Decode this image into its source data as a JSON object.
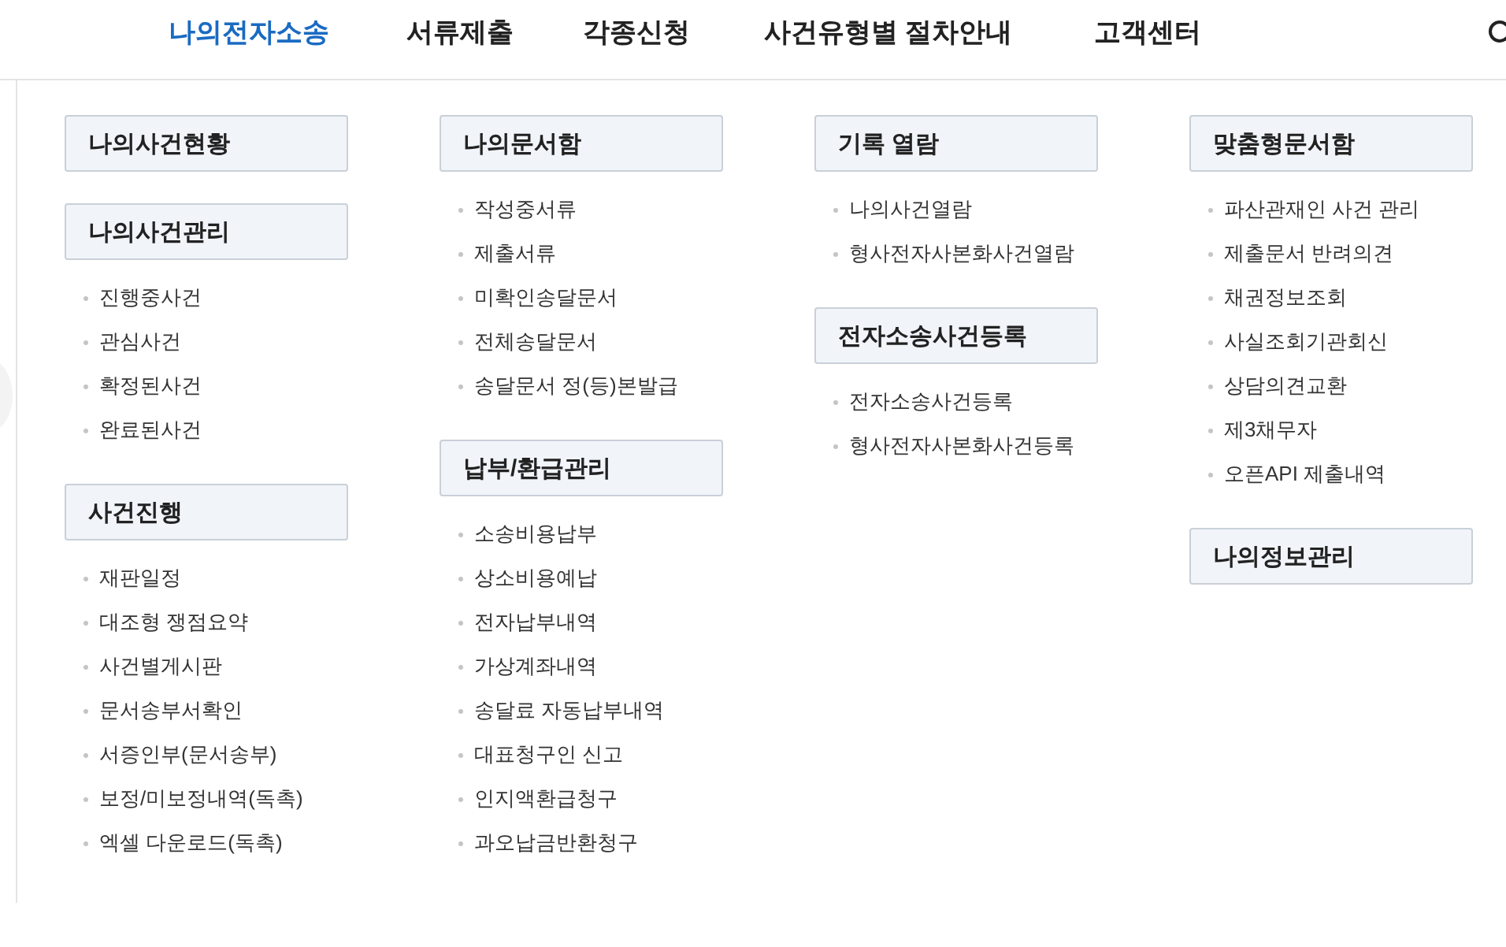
{
  "nav": [
    {
      "label": "나의전자소송",
      "selected": true
    },
    {
      "label": "서류제출",
      "selected": false
    },
    {
      "label": "각종신청",
      "selected": false
    },
    {
      "label": "사건유형별 절차안내",
      "selected": false
    },
    {
      "label": "고객센터",
      "selected": false
    }
  ],
  "columns": [
    {
      "sections": [
        {
          "title": "나의사건현황"
        },
        {
          "title": "나의사건관리",
          "items": [
            "진행중사건",
            "관심사건",
            "확정된사건",
            "완료된사건"
          ]
        },
        {
          "title": "사건진행",
          "items": [
            "재판일정",
            "대조형 쟁점요약",
            "사건별게시판",
            "문서송부서확인",
            "서증인부(문서송부)",
            "보정/미보정내역(독촉)",
            "엑셀 다운로드(독촉)"
          ]
        }
      ]
    },
    {
      "sections": [
        {
          "title": "나의문서함",
          "items": [
            "작성중서류",
            "제출서류",
            "미확인송달문서",
            "전체송달문서",
            "송달문서 정(등)본발급"
          ]
        },
        {
          "title": "납부/환급관리",
          "items": [
            "소송비용납부",
            "상소비용예납",
            "전자납부내역",
            "가상계좌내역",
            "송달료 자동납부내역",
            "대표청구인 신고",
            "인지액환급청구",
            "과오납금반환청구"
          ]
        }
      ]
    },
    {
      "sections": [
        {
          "title": "기록 열람",
          "items": [
            "나의사건열람",
            "형사전자사본화사건열람"
          ]
        },
        {
          "title": "전자소송사건등록",
          "items": [
            "전자소송사건등록",
            "형사전자사본화사건등록"
          ]
        }
      ]
    },
    {
      "sections": [
        {
          "title": "맞춤형문서함",
          "items": [
            "파산관재인 사건 관리",
            "제출문서 반려의견",
            "채권정보조회",
            "사실조회기관회신",
            "상담의견교환",
            "제3채무자",
            "오픈API 제출내역"
          ]
        },
        {
          "title": "나의정보관리"
        }
      ]
    }
  ]
}
